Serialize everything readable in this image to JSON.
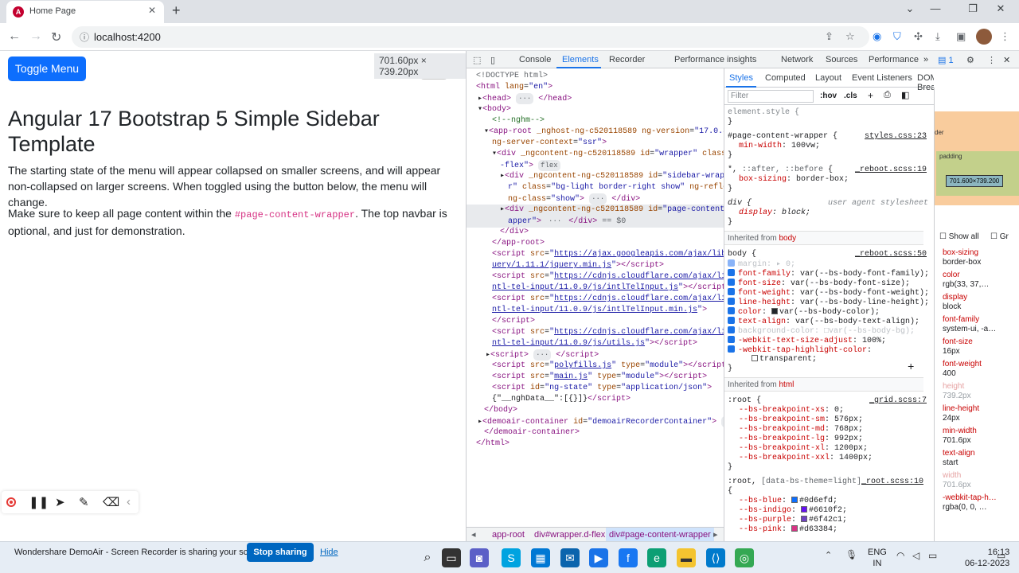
{
  "browser": {
    "tab_title": "Home Page",
    "url": "localhost:4200"
  },
  "page": {
    "toggle_label": "Toggle Menu",
    "dimension_tooltip": "701.60px × 739.20px",
    "title": "Angular 17 Bootstrap 5 Simple Sidebar Template",
    "para1": "The starting state of the menu will appear collapsed on smaller screens, and will appear non-collapsed on larger screens. When toggled using the button below, the menu will change.",
    "para2_before": "Make sure to keep all page content within the ",
    "para2_code": "#page-content-wrapper",
    "para2_after": ". The top navbar is optional, and just for demonstration."
  },
  "devtools": {
    "tabs": [
      "Console",
      "Elements",
      "Recorder",
      "Performance insights",
      "Network",
      "Sources",
      "Performance"
    ],
    "active_tab": "Elements",
    "issues_count": "1",
    "styles_tabs": [
      "Styles",
      "Computed",
      "Layout",
      "Event Listeners",
      "DOM Breakpoints"
    ],
    "filter_placeholder": "Filter",
    "hov": ":hov",
    "cls": ".cls",
    "breadcrumbs": [
      "app-root",
      "div#wrapper.d-flex",
      "div#page-content-wrapper"
    ],
    "box_model_content": "701.600×739.200",
    "box_model_padding_label": "padding",
    "box_model_border_label": "der",
    "show_all": "Show all",
    "group": "Gr",
    "computed": [
      {
        "name": "box-sizing",
        "value": "border-box"
      },
      {
        "name": "color",
        "value": "rgb(33, 37,…"
      },
      {
        "name": "display",
        "value": "block"
      },
      {
        "name": "font-family",
        "value": "system-ui, -a…"
      },
      {
        "name": "font-size",
        "value": "16px"
      },
      {
        "name": "font-weight",
        "value": "400"
      },
      {
        "name": "height",
        "value": "739.2px"
      },
      {
        "name": "line-height",
        "value": "24px"
      },
      {
        "name": "min-width",
        "value": "701.6px"
      },
      {
        "name": "text-align",
        "value": "start"
      },
      {
        "name": "width",
        "value": "701.6px"
      },
      {
        "name": "-webkit-tap-h…",
        "value": "rgba(0, 0, …"
      }
    ]
  },
  "recorder": {
    "share_text": "Wondershare DemoAir - Screen Recorder is sharing your screen.",
    "stop_label": "Stop sharing",
    "hide_label": "Hide"
  },
  "taskbar": {
    "lang_top": "ENG",
    "lang_bottom": "IN",
    "time": "16:13",
    "date": "06-12-2023"
  },
  "colors": {
    "bs_blue": "#0d6efd",
    "bs_indigo": "#6610f2",
    "bs_purple": "#6f42c1",
    "bs_pink": "#d63384"
  }
}
